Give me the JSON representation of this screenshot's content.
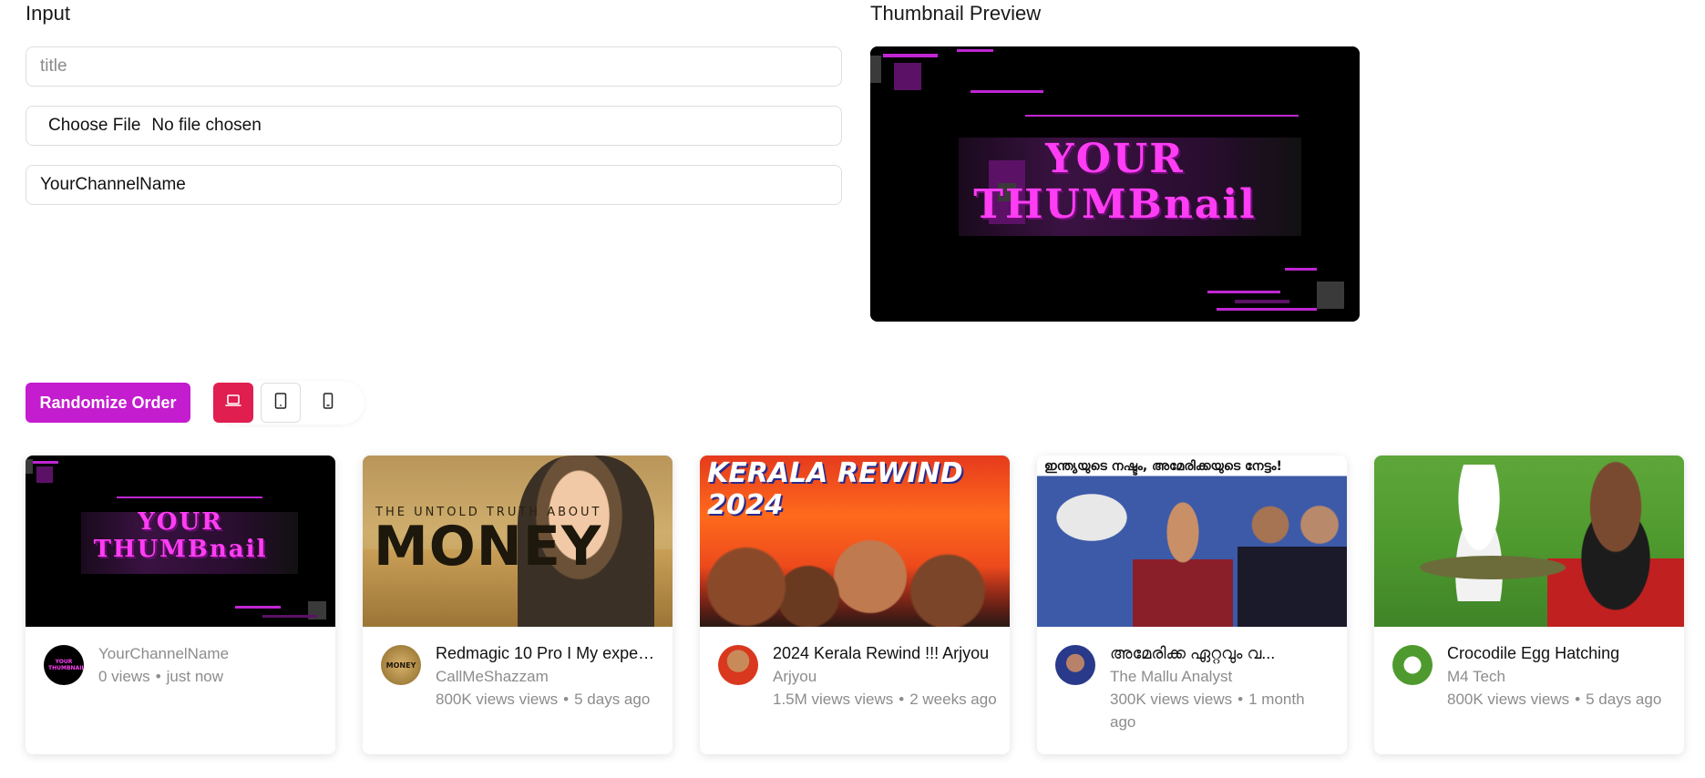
{
  "input_section": {
    "label": "Input",
    "title_placeholder": "title",
    "file_button": "Choose File",
    "file_status": "No file chosen",
    "channel_value": "YourChannelName"
  },
  "preview_section": {
    "label": "Thumbnail Preview",
    "thumb_line1": "YOUR",
    "thumb_line2": "THUMBnail"
  },
  "controls": {
    "randomize_label": "Randomize Order",
    "view_modes": [
      {
        "name": "laptop",
        "icon": "laptop-icon",
        "active": true
      },
      {
        "name": "tablet",
        "icon": "tablet-icon",
        "active": false
      },
      {
        "name": "phone",
        "icon": "phone-icon",
        "active": false
      }
    ],
    "active_color": "#e01e4f",
    "accent_color": "#c41ccf"
  },
  "videos": [
    {
      "title": "",
      "channel": "YourChannelName",
      "views": "0 views",
      "age": "just now",
      "avatar_text": "YOUR THUMBNAIL"
    },
    {
      "title": "Redmagic 10 Pro I My experi...",
      "channel": "CallMeShazzam",
      "views": "800K views views",
      "age": "5 days ago",
      "thumb_small": "THE UNTOLD TRUTH ABOUT",
      "thumb_big": "MONEY",
      "avatar_text": "MONEY"
    },
    {
      "title": "2024 Kerala Rewind !!! Arjyou",
      "channel": "Arjyou",
      "views": "1.5M views views",
      "age": "2 weeks ago",
      "thumb_text": "KERALA REWIND 2024"
    },
    {
      "title": "അമേരിക്ക ഏറ്റവും വ...",
      "channel": "The Mallu Analyst",
      "views": "300K views views",
      "age": "1 month ago",
      "thumb_text": "ഇന്ത്യയുടെ നഷ്ടം, അമേരിക്കയുടെ നേട്ടം!"
    },
    {
      "title": "Crocodile Egg Hatching",
      "channel": "M4 Tech",
      "views": "800K views views",
      "age": "5 days ago"
    }
  ]
}
